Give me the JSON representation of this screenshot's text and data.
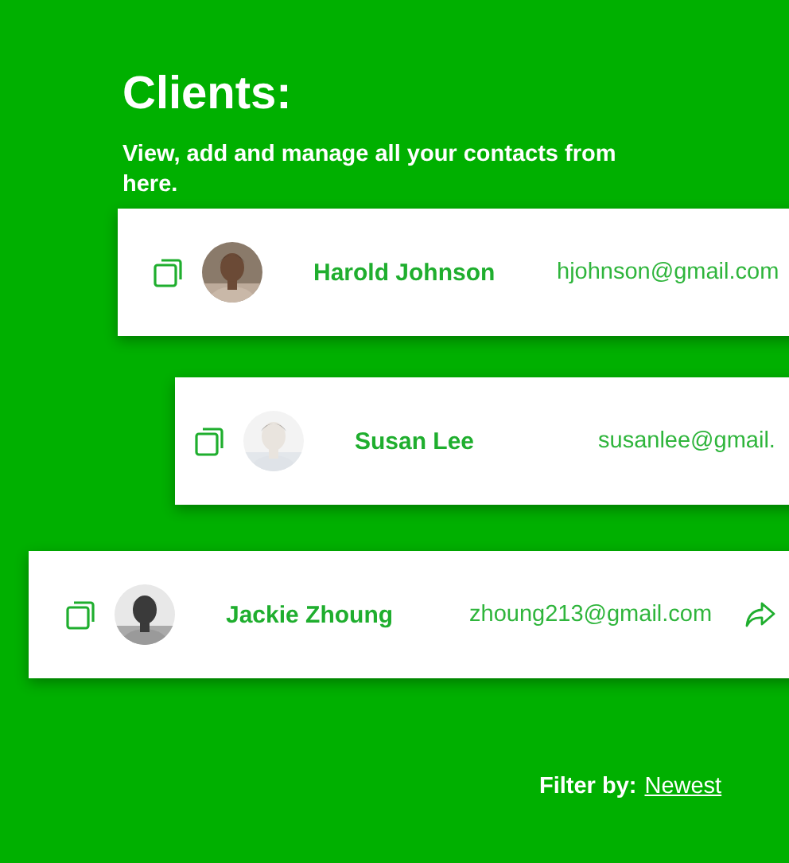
{
  "title": "Clients:",
  "subtitle": "View, add and manage all your contacts from here.",
  "clients": [
    {
      "name": "Harold Johnson",
      "email": "hjohnson@gmail.com"
    },
    {
      "name": "Susan Lee",
      "email": "susanlee@gmail."
    },
    {
      "name": "Jackie Zhoung",
      "email": "zhoung213@gmail.com",
      "share": true
    }
  ],
  "filter": {
    "label": "Filter by:",
    "value": "Newest"
  }
}
